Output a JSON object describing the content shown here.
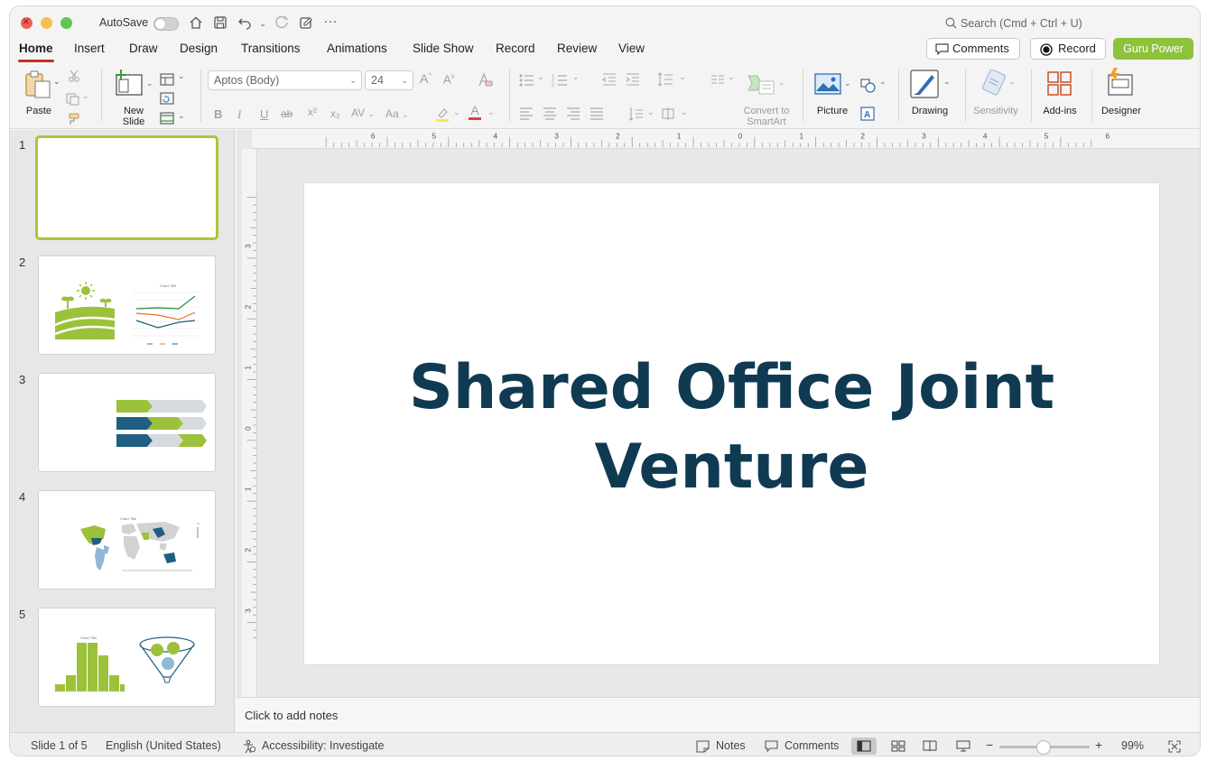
{
  "titlebar": {
    "autosave_label": "AutoSave",
    "search_placeholder": "Search (Cmd + Ctrl + U)"
  },
  "ribbon_tabs": [
    {
      "label": "Home",
      "active": true
    },
    {
      "label": "Insert"
    },
    {
      "label": "Draw"
    },
    {
      "label": "Design"
    },
    {
      "label": "Transitions"
    },
    {
      "label": "Animations"
    },
    {
      "label": "Slide Show"
    },
    {
      "label": "Record"
    },
    {
      "label": "Review"
    },
    {
      "label": "View"
    }
  ],
  "top_buttons": {
    "comments": "Comments",
    "record": "Record",
    "guru": "Guru Power"
  },
  "ribbon": {
    "paste": "Paste",
    "new_slide": "New\nSlide",
    "font_name": "Aptos (Body)",
    "font_size": "24",
    "convert_smartart": "Convert to\nSmartArt",
    "picture": "Picture",
    "drawing": "Drawing",
    "sensitivity": "Sensitivity",
    "addins": "Add-ins",
    "designer": "Designer",
    "bold": "B",
    "italic": "I",
    "underline": "U",
    "strike": "ab",
    "superscript": "x²",
    "subscript": "x₂",
    "spacing": "AV",
    "case": "Aa",
    "increase_font": "A",
    "decrease_font": "A",
    "font_color": "A"
  },
  "thumbnails": [
    {
      "num": "1",
      "selected": true
    },
    {
      "num": "2"
    },
    {
      "num": "3"
    },
    {
      "num": "4"
    },
    {
      "num": "5"
    }
  ],
  "thumb_text": {
    "chart_title": "Chart Title"
  },
  "ruler": {
    "h_labels": [
      "6",
      "5",
      "4",
      "3",
      "2",
      "1",
      "0",
      "1",
      "2",
      "3",
      "4",
      "5",
      "6"
    ],
    "v_labels": [
      "3",
      "2",
      "1",
      "0",
      "1",
      "2",
      "3"
    ]
  },
  "slide": {
    "title_line1": "Shared Office Joint",
    "title_line2": "Venture"
  },
  "notes_placeholder": "Click to add notes",
  "status": {
    "slide_counter": "Slide 1 of 5",
    "language": "English (United States)",
    "accessibility": "Accessibility: Investigate",
    "notes": "Notes",
    "comments": "Comments",
    "zoom_minus": "−",
    "zoom_plus": "+",
    "zoom_level": "99%"
  },
  "colors": {
    "accent_red": "#c4311a",
    "guru_green": "#8dc23c",
    "title_navy": "#0f3a52",
    "thumb_select": "#b1c13a"
  }
}
